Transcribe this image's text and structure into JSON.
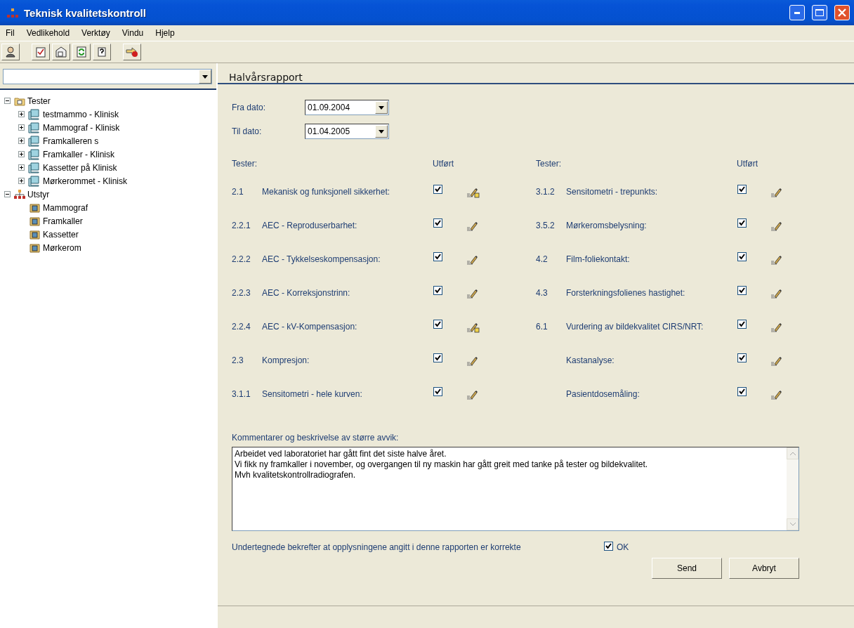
{
  "window": {
    "title": "Teknisk kvalitetskontroll"
  },
  "menu": [
    "Fil",
    "Vedlikehold",
    "Verktøy",
    "Vindu",
    "Hjelp"
  ],
  "tree": [
    {
      "label": "Tester",
      "kind": "folder",
      "expanded": true,
      "children": [
        {
          "label": "testmammo - Klinisk",
          "kind": "station",
          "expanded": false
        },
        {
          "label": "Mammograf - Klinisk",
          "kind": "station",
          "expanded": false
        },
        {
          "label": "Framkalleren s",
          "kind": "station",
          "expanded": false
        },
        {
          "label": "Framkaller - Klinisk",
          "kind": "station",
          "expanded": false
        },
        {
          "label": "Kassetter på Klinisk",
          "kind": "station",
          "expanded": false
        },
        {
          "label": "Mørkerommet - Klinisk",
          "kind": "station",
          "expanded": false
        }
      ]
    },
    {
      "label": "Utstyr",
      "kind": "network",
      "expanded": true,
      "children": [
        {
          "label": "Mammograf",
          "kind": "device"
        },
        {
          "label": "Framkaller",
          "kind": "device"
        },
        {
          "label": "Kassetter",
          "kind": "device"
        },
        {
          "label": "Mørkerom",
          "kind": "device"
        }
      ]
    }
  ],
  "report": {
    "title": "Halvårsrapport",
    "dates": [
      {
        "label": "Fra dato:",
        "value": "01.09.2004"
      },
      {
        "label": "Til dato:",
        "value": "01.04.2005"
      }
    ],
    "columns": [
      {
        "tests_header": "Tester:",
        "done_header": "Utført",
        "rows": [
          {
            "number": "2.1",
            "name": "Mekanisk og funksjonell sikkerhet:",
            "checked": true,
            "locked": true
          },
          {
            "number": "2.2.1",
            "name": "AEC - Reproduserbarhet:",
            "checked": true,
            "locked": false
          },
          {
            "number": "2.2.2",
            "name": "AEC - Tykkelseskompensasjon:",
            "checked": true,
            "locked": false
          },
          {
            "number": "2.2.3",
            "name": "AEC - Korreksjonstrinn:",
            "checked": true,
            "locked": false
          },
          {
            "number": "2.2.4",
            "name": "AEC - kV-Kompensasjon:",
            "checked": true,
            "locked": true
          },
          {
            "number": "2.3",
            "name": "Kompresjon:",
            "checked": true,
            "locked": false
          },
          {
            "number": "3.1.1",
            "name": "Sensitometri - hele kurven:",
            "checked": true,
            "locked": false
          }
        ]
      },
      {
        "tests_header": "Tester:",
        "done_header": "Utført",
        "rows": [
          {
            "number": "3.1.2",
            "name": "Sensitometri - trepunkts:",
            "checked": true,
            "locked": false
          },
          {
            "number": "3.5.2",
            "name": "Mørkeromsbelysning:",
            "checked": true,
            "locked": false
          },
          {
            "number": "4.2",
            "name": "Film-foliekontakt:",
            "checked": true,
            "locked": false
          },
          {
            "number": "4.3",
            "name": "Forsterkningsfolienes hastighet:",
            "checked": true,
            "locked": false
          },
          {
            "number": "6.1",
            "name": "Vurdering av bildekvalitet CIRS/NRT:",
            "checked": true,
            "locked": false
          },
          {
            "name": "Kastanalyse:",
            "checked": true,
            "locked": false
          },
          {
            "name": "Pasientdosemåling:",
            "checked": true,
            "locked": false
          }
        ]
      }
    ],
    "comment_label": "Kommentarer og beskrivelse av større avvik:",
    "comment": "Arbeidet ved laboratoriet har gått fint det siste halve året.\nVi fikk ny framkaller i november, og overgangen til ny maskin har gått greit med tanke på tester og bildekvalitet.\nMvh kvalitetskontrollradiografen.",
    "confirm_text": "Undertegnede bekrefter at opplysningene angitt i denne rapporten er korrekte",
    "confirm": {
      "label": "OK",
      "checked": true
    },
    "buttons": [
      "Send",
      "Avbryt"
    ]
  }
}
